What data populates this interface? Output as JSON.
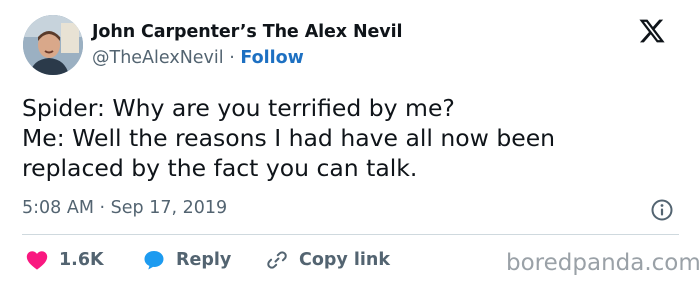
{
  "author": {
    "display_name": "John Carpenter’s The Alex Nevil",
    "handle": "@TheAlexNevil",
    "separator": "·",
    "follow_label": "Follow"
  },
  "icons": {
    "platform": "x-logo-icon",
    "info": "info-icon",
    "like": "heart-icon",
    "reply": "speech-bubble-icon",
    "copy": "link-icon"
  },
  "tweet": {
    "lines": [
      "Spider: Why are you terrified by me?",
      "Me: Well the reasons I had have all now been",
      "replaced by the fact you can talk."
    ]
  },
  "meta": {
    "time": "5:08 AM",
    "separator": "·",
    "date": "Sep 17, 2019"
  },
  "actions": {
    "like_count": "1.6K",
    "reply_label": "Reply",
    "copy_label": "Copy link"
  },
  "watermark": "boredpanda.com",
  "colors": {
    "follow": "#1d70c2",
    "like": "#f91880",
    "reply": "#1d9bf0",
    "secondary_text": "#536471"
  }
}
